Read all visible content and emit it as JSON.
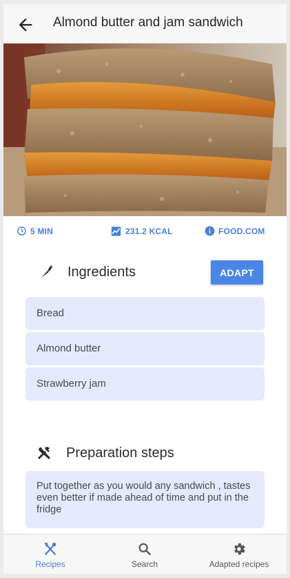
{
  "header": {
    "title": "Almond butter and jam sandwich",
    "back_icon": "arrow-left-icon"
  },
  "hero": {
    "alt": "Almond butter and jam sandwich"
  },
  "meta": [
    {
      "icon": "clock-icon",
      "label": "5 MIN"
    },
    {
      "icon": "chart-icon",
      "label": "231.2 KCAL"
    },
    {
      "icon": "info-icon",
      "label": "FOOD.COM"
    }
  ],
  "ingredients": {
    "title": "Ingredients",
    "icon": "carrot-icon",
    "adapt_label": "ADAPT",
    "items": [
      "Bread",
      "Almond butter",
      "Strawberry jam"
    ]
  },
  "steps": {
    "title": "Preparation steps",
    "icon": "tools-icon",
    "items": [
      "Put together as you would any sandwich , tastes even better if made ahead of time and put in the fridge"
    ]
  },
  "nav": {
    "items": [
      {
        "label": "Recipes",
        "icon": "utensils-icon",
        "active": true
      },
      {
        "label": "Search",
        "icon": "search-icon",
        "active": false
      },
      {
        "label": "Adapted recipes",
        "icon": "gear-icon",
        "active": false
      }
    ]
  },
  "colors": {
    "accent": "#4a86e8",
    "card": "#e4eafc",
    "active_nav": "#4a7fd7"
  }
}
